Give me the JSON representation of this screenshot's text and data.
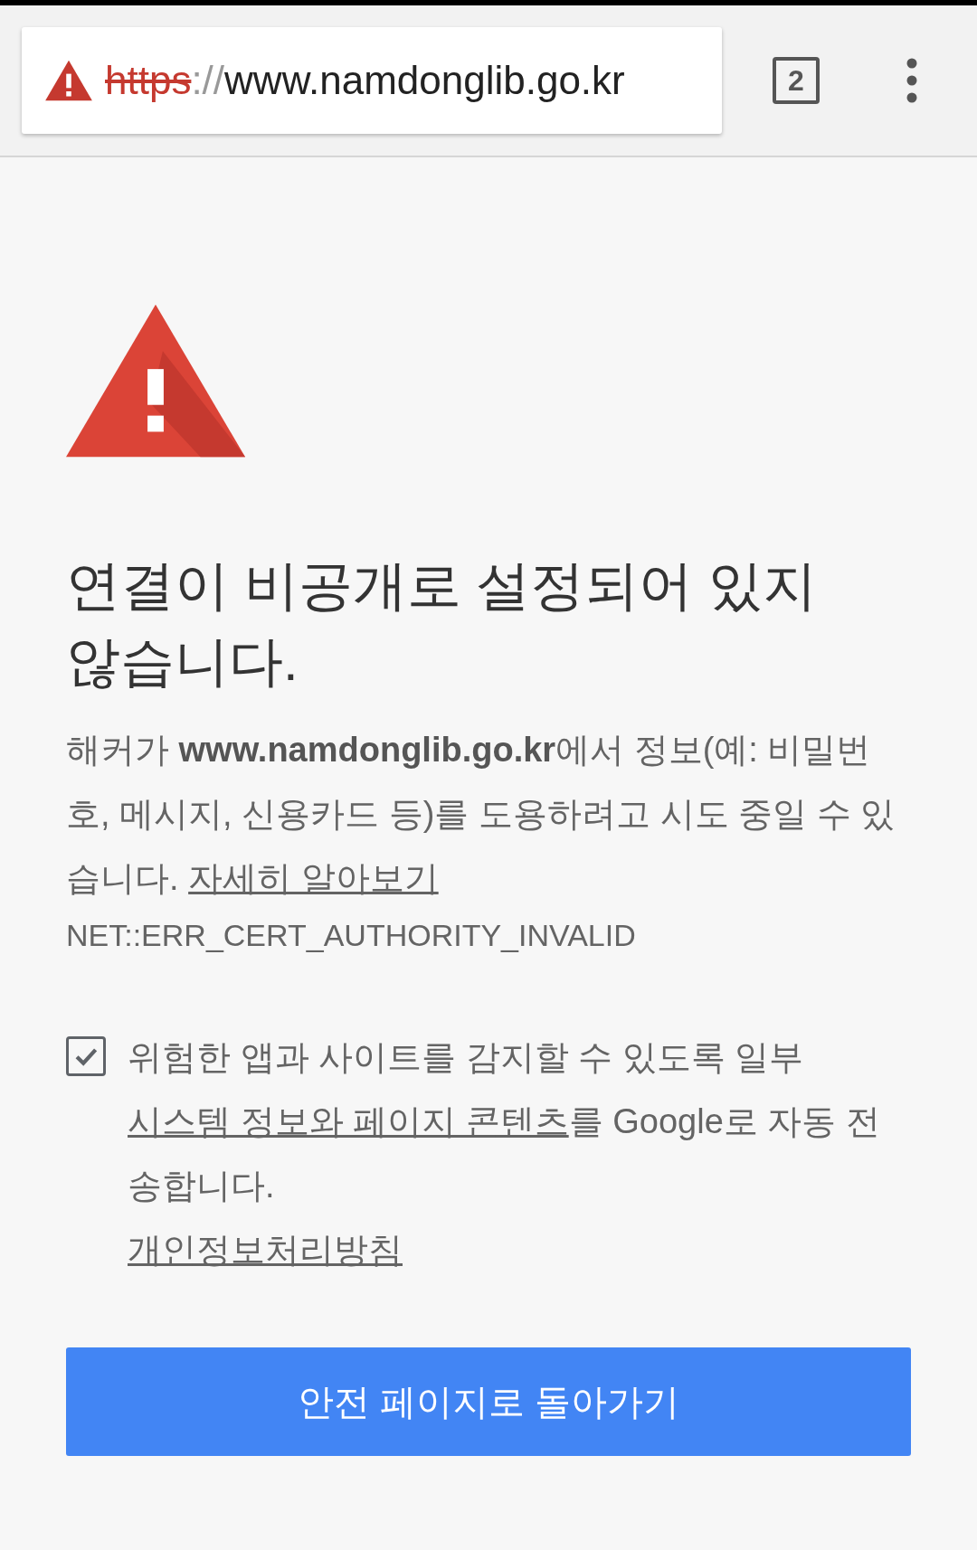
{
  "toolbar": {
    "url": {
      "scheme": "https",
      "separator": "://",
      "host": "www.namdonglib.go.kr",
      "insecure": true
    },
    "tab_count": "2"
  },
  "interstitial": {
    "heading": "연결이 비공개로 설정되어 있지 않습니다.",
    "body": "해커가 **www.namdonglib.go.kr**에서 정보(예: 비밀번호, 메시지, 신용카드 등)를 도용하려고 시도 중일 수 있습니다.",
    "learn_more": "자세히 알아보기",
    "error_code": "NET::ERR_CERT_AUTHORITY_INVALID",
    "report": {
      "checked": true,
      "text_before": "위험한 앱과 사이트를 감지할 수 있도록 일부",
      "link": "시스템 정보와 페이지 콘텐츠",
      "text_after": "를 Google로 자동 전송합니다.",
      "privacy_link": "개인정보처리방침"
    },
    "back_button": "안전 페이지로 돌아가기"
  }
}
